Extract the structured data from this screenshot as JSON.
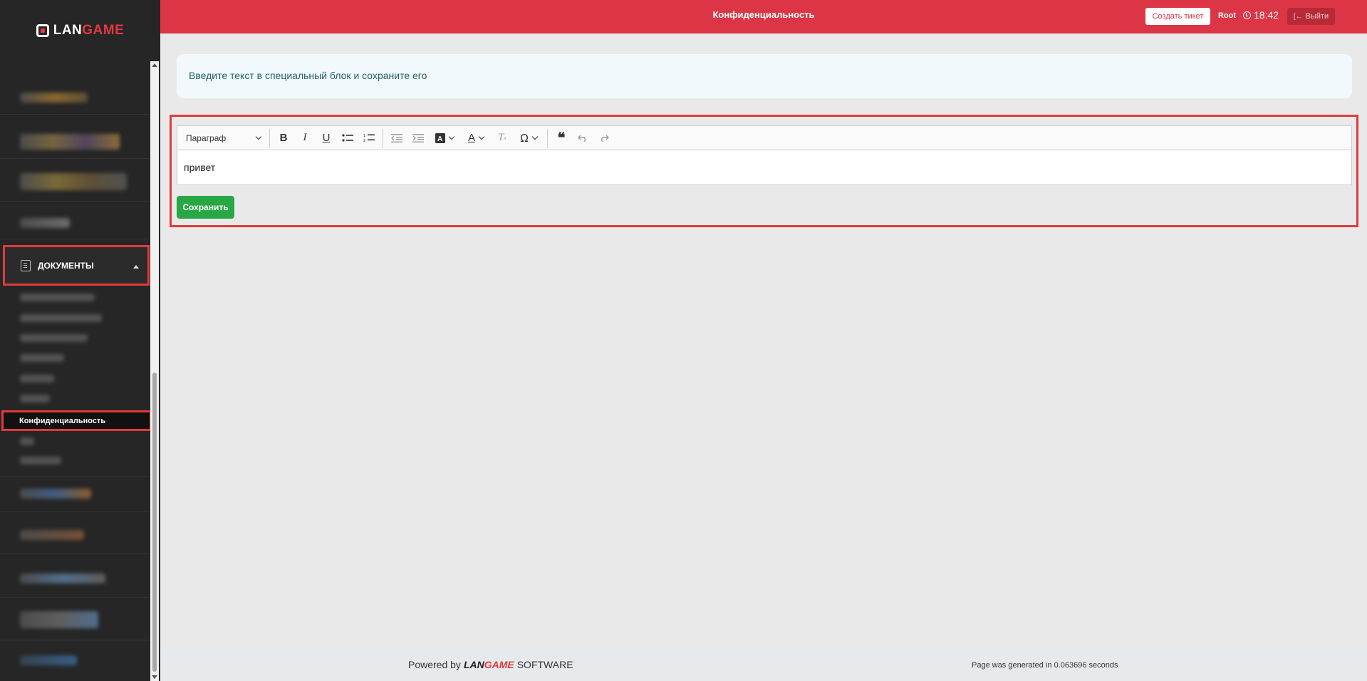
{
  "app": {
    "logo_prefix": "LAN",
    "logo_suffix": "GAME",
    "page_title": "Конфиденциальность"
  },
  "header": {
    "create_ticket": "Создать тикет",
    "user": "Root",
    "time": "18:42",
    "logout": "Выйти"
  },
  "sidebar": {
    "section_label": "ДОКУМЕНТЫ",
    "active_item": "Конфиденциальность"
  },
  "main": {
    "info_text": "Введите текст в специальный блок и сохраните его",
    "toolbar": {
      "paragraph_select": "Параграф"
    },
    "editor_content": "привет",
    "save_button": "Сохранить"
  },
  "footer": {
    "powered_by": "Powered by",
    "brand_prefix": "LAN",
    "brand_suffix": "GAME",
    "software": "SOFTWARE",
    "generated": "Page was generated in 0.063696 seconds"
  },
  "colors": {
    "header": "#dc3545",
    "sidebar": "#262626",
    "highlight": "#e23a3a",
    "save": "#28a745"
  }
}
